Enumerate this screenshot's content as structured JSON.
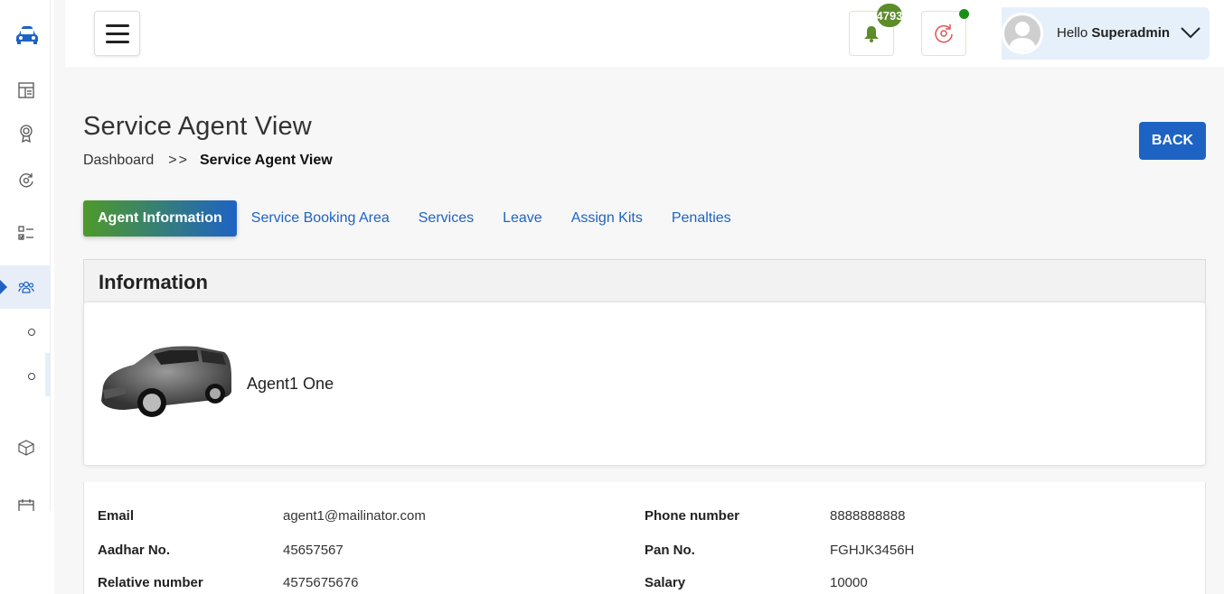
{
  "sidebar": {
    "logo_icon": "car-icon",
    "items": [
      {
        "icon": "layout-icon"
      },
      {
        "icon": "award-icon"
      },
      {
        "icon": "settings-refresh-icon"
      },
      {
        "icon": "checklist-icon"
      },
      {
        "icon": "users-icon",
        "active": true
      },
      {
        "icon": "box-icon"
      },
      {
        "icon": "calendar-icon"
      }
    ]
  },
  "header": {
    "notifications_count": "4793",
    "greeting": "Hello",
    "username": "Superadmin"
  },
  "page": {
    "title": "Service Agent View",
    "breadcrumb_home": "Dashboard",
    "breadcrumb_sep": ">>",
    "breadcrumb_current": "Service Agent View",
    "back_label": "BACK"
  },
  "tabs": [
    {
      "label": "Agent Information",
      "active": true
    },
    {
      "label": "Service Booking Area"
    },
    {
      "label": "Services"
    },
    {
      "label": "Leave"
    },
    {
      "label": "Assign Kits"
    },
    {
      "label": "Penalties"
    }
  ],
  "info": {
    "heading": "Information",
    "agent_name": "Agent1 One",
    "fields": {
      "email_label": "Email",
      "email_value": "agent1@mailinator.com",
      "phone_label": "Phone number",
      "phone_value": "8888888888",
      "aadhar_label": "Aadhar No.",
      "aadhar_value": "45657567",
      "pan_label": "Pan No.",
      "pan_value": "FGHJK3456H",
      "relative_label": "Relative number",
      "relative_value": "4575675676",
      "salary_label": "Salary",
      "salary_value": "10000"
    }
  },
  "colors": {
    "primary": "#1e63c4",
    "green": "#4e9a2a",
    "badge": "#5d8c2a",
    "online": "#1a8f1a"
  }
}
